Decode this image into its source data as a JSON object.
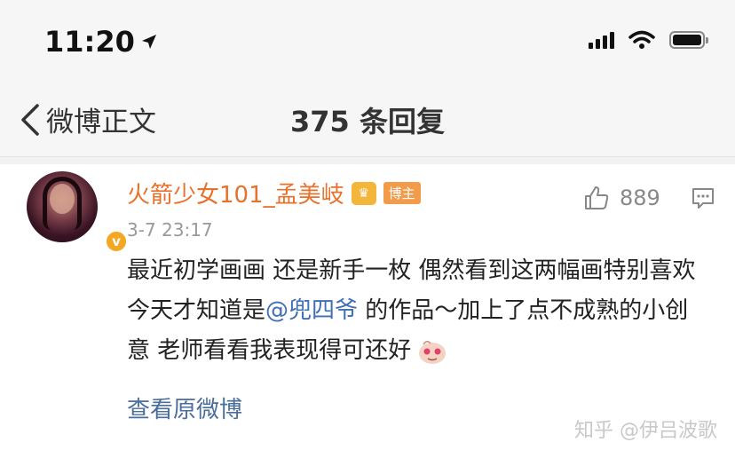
{
  "status_bar": {
    "time": "11:20"
  },
  "nav": {
    "back_label": "微博正文",
    "title": "375 条回复"
  },
  "comment": {
    "username": "火箭少女101_孟美岐",
    "badge": "博主",
    "timestamp": "3-7 23:17",
    "like_count": "889",
    "text_before_mention": "最近初学画画 还是新手一枚 偶然看到这两幅画特别喜欢 今天才知道是",
    "mention": "@兜四爷",
    "text_after_mention": " 的作品～加上了点不成熟的小创意 老师看看我表现得可还好",
    "view_original": "查看原微博"
  },
  "watermark": "知乎 @伊吕波歌",
  "colors": {
    "username": "#e8712b",
    "mention": "#3f6fb5",
    "link": "#4a6d9c",
    "badge_bg": "#f29b4a"
  },
  "icons": [
    "location-arrow-icon",
    "signal-icon",
    "wifi-icon",
    "battery-icon",
    "back-chevron-icon",
    "verified-icon",
    "vip-crown-icon",
    "thumbs-up-icon",
    "comment-icon",
    "emoji-sticker-icon"
  ]
}
